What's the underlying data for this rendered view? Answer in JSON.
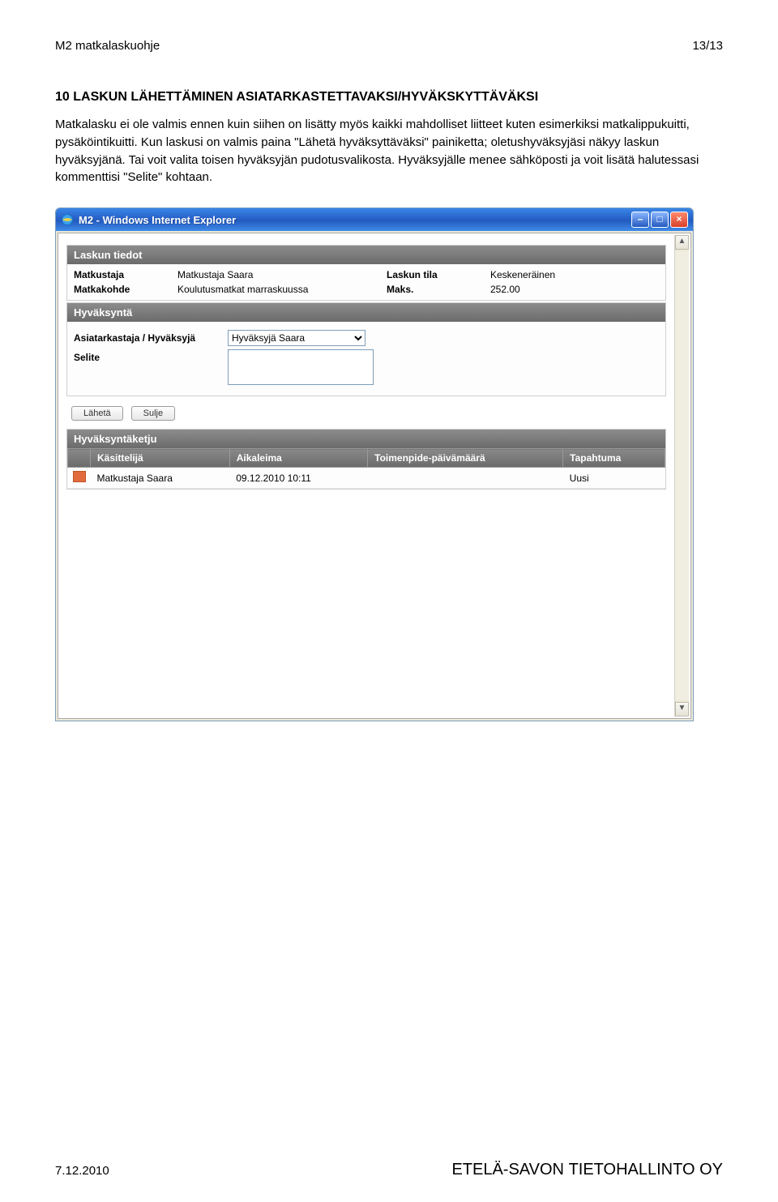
{
  "doc_header": {
    "left": "M2 matkalaskuohje",
    "right": "13/13"
  },
  "section_heading": "10 LASKUN LÄHETTÄMINEN ASIATARKASTETTAVAKSI/HYVÄKSKYTTÄVÄKSI",
  "body_text": "Matkalasku ei ole valmis ennen kuin siihen on lisätty myös kaikki mahdolliset liitteet kuten esimerkiksi matkalippukuitti, pysäköintikuitti. Kun laskusi on valmis paina \"Lähetä hyväksyttäväksi\" painiketta; oletushyväksyjäsi näkyy laskun hyväksyjänä. Tai voit valita toisen hyväksyjän pudotusvalikosta. Hyväksyjälle menee sähköposti ja voit lisätä halutessasi kommenttisi \"Selite\" kohtaan.",
  "window": {
    "title": "M2 - Windows Internet Explorer"
  },
  "panels": {
    "laskun_tiedot": {
      "title": "Laskun tiedot",
      "rows": {
        "matkustaja_label": "Matkustaja",
        "matkustaja_value": "Matkustaja Saara",
        "laskun_tila_label": "Laskun tila",
        "laskun_tila_value": "Keskeneräinen",
        "matkakohde_label": "Matkakohde",
        "matkakohde_value": "Koulutusmatkat marraskuussa",
        "maks_label": "Maks.",
        "maks_value": "252.00"
      }
    },
    "hyvaksynta": {
      "title": "Hyväksyntä",
      "asiatarkastaja_label": "Asiatarkastaja / Hyväksyjä",
      "asiatarkastaja_value": "Hyväksyjä Saara",
      "selite_label": "Selite",
      "selite_value": ""
    },
    "ketju": {
      "title": "Hyväksyntäketju",
      "columns": {
        "kasittelija": "Käsittelijä",
        "aikaleima": "Aikaleima",
        "toimenpide": "Toimenpide-päivämäärä",
        "tapahtuma": "Tapahtuma"
      },
      "rows": [
        {
          "kasittelija": "Matkustaja Saara",
          "aikaleima": "09.12.2010 10:11",
          "toimenpide": "",
          "tapahtuma": "Uusi",
          "status_color": "#e26b3d"
        }
      ]
    }
  },
  "buttons": {
    "laheta": "Lähetä",
    "sulje": "Sulje"
  },
  "footer": {
    "date": "7.12.2010",
    "brand_part1": "ETELÄ-SAVON",
    "brand_part2": "TIETOHALLINTO",
    "brand_part3": "OY"
  }
}
